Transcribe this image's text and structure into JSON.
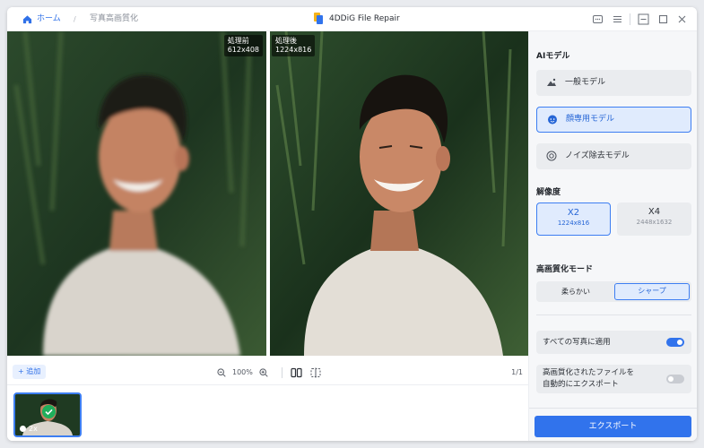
{
  "breadcrumb": {
    "home_label": "ホーム",
    "separator": "/",
    "page_label": "写真高画質化"
  },
  "app": {
    "title": "4DDiG File Repair",
    "logo_icon": "app-logo-icon"
  },
  "titlebar_icons": [
    "feedback-icon",
    "menu-icon",
    "minimize-icon",
    "maximize-icon",
    "close-icon"
  ],
  "viewer": {
    "before": {
      "label": "処理前",
      "size": "612x408"
    },
    "after": {
      "label": "処理後",
      "size": "1224x816"
    }
  },
  "toolbar": {
    "add_label": "+ 追加",
    "zoom_level": "100%",
    "page_count": "1/1"
  },
  "thumbnail": {
    "scale": "2x"
  },
  "panel": {
    "ai_model_title": "AIモデル",
    "models": [
      {
        "label": "一般モデル",
        "icon": "landscape-icon",
        "selected": false
      },
      {
        "label": "顔専用モデル",
        "icon": "face-icon",
        "selected": true
      },
      {
        "label": "ノイズ除去モデル",
        "icon": "denoise-icon",
        "selected": false
      }
    ],
    "resolution_title": "解像度",
    "resolutions": [
      {
        "label": "X2",
        "dims": "1224x816",
        "selected": true
      },
      {
        "label": "X4",
        "dims": "2448x1632",
        "selected": false
      }
    ],
    "mode_title": "高画質化モード",
    "modes": [
      {
        "label": "柔らかい",
        "selected": false
      },
      {
        "label": "シャープ",
        "selected": true
      }
    ],
    "apply_all": {
      "label": "すべての写真に適用",
      "on": true
    },
    "auto_export": {
      "label_line1": "高画質化されたファイルを",
      "label_line2": "自動的にエクスポート",
      "on": false
    },
    "export_label": "エクスポート"
  },
  "colors": {
    "accent": "#3173ec",
    "success": "#1fae5b",
    "panel_bg": "#f6f7f9"
  }
}
